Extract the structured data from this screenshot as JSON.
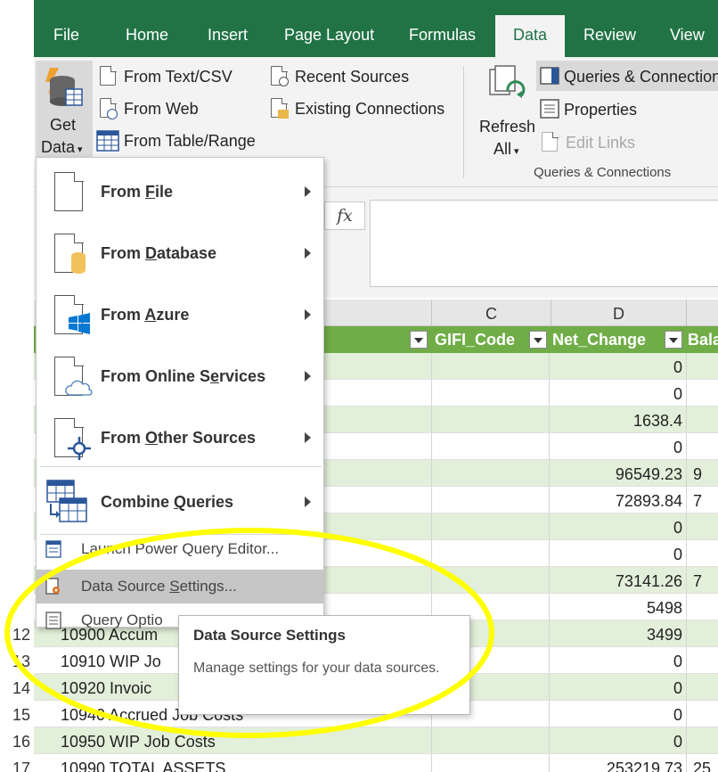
{
  "menubar": {
    "tabs": [
      "File",
      "Home",
      "Insert",
      "Page Layout",
      "Formulas",
      "Data",
      "Review",
      "View"
    ],
    "active": "Data"
  },
  "ribbon": {
    "get_data": [
      "Get",
      "Data"
    ],
    "get_transform": [
      "From Text/CSV",
      "From Web",
      "From Table/Range"
    ],
    "recent": [
      "Recent Sources",
      "Existing Connections"
    ],
    "refresh": [
      "Refresh",
      "All"
    ],
    "queries": [
      "Queries & Connections",
      "Properties",
      "Edit Links"
    ],
    "group_label": "Queries & Connections"
  },
  "formula_bar": {
    "fx": "fx"
  },
  "columns": {
    "c": "C",
    "d": "D"
  },
  "table_header": {
    "gifi": "GIFI_Code",
    "net": "Net_Change",
    "bal": "Bala"
  },
  "rows": [
    {
      "num": "",
      "text": "",
      "net": "0",
      "bal": ""
    },
    {
      "num": "",
      "text": "",
      "net": "0",
      "bal": ""
    },
    {
      "num": "",
      "text": "",
      "net": "1638.4",
      "bal": ""
    },
    {
      "num": "",
      "text": "",
      "net": "0",
      "bal": ""
    },
    {
      "num": "",
      "text": "",
      "net": "96549.23",
      "bal": "9"
    },
    {
      "num": "",
      "text": "",
      "net": "72893.84",
      "bal": "7"
    },
    {
      "num": "",
      "text": "",
      "net": "0",
      "bal": ""
    },
    {
      "num": "",
      "text": "",
      "net": "0",
      "bal": ""
    },
    {
      "num": "",
      "text": "",
      "net": "73141.26",
      "bal": "7"
    },
    {
      "num": "",
      "text": "",
      "net": "5498",
      "bal": ""
    },
    {
      "num": "12",
      "text": "10900 Accum",
      "net": "3499",
      "bal": ""
    },
    {
      "num": "13",
      "text": "10910 WIP Jo",
      "net": "0",
      "bal": ""
    },
    {
      "num": "14",
      "text": "10920 Invoic",
      "net": "0",
      "bal": ""
    },
    {
      "num": "15",
      "text": "10940 Accrued Job Costs",
      "net": "0",
      "bal": ""
    },
    {
      "num": "16",
      "text": "10950 WIP Job Costs",
      "net": "0",
      "bal": ""
    },
    {
      "num": "17",
      "text": "10990 TOTAL ASSETS",
      "net": "253219.73",
      "bal": "25"
    }
  ],
  "dropdown": {
    "items": [
      {
        "pre": "From ",
        "u": "F",
        "post": "ile"
      },
      {
        "pre": "From ",
        "u": "D",
        "post": "atabase"
      },
      {
        "pre": "From ",
        "u": "A",
        "post": "zure"
      },
      {
        "pre": "From Online S",
        "u": "e",
        "post": "rvices"
      },
      {
        "pre": "From ",
        "u": "O",
        "post": "ther Sources"
      },
      {
        "pre": "Combine ",
        "u": "Q",
        "post": "ueries"
      }
    ],
    "small": [
      {
        "pre": "L",
        "u": "a",
        "post": "unch Power Query Editor..."
      },
      {
        "pre": "Data Source ",
        "u": "S",
        "post": "ettings..."
      },
      {
        "pre": "Query Optio",
        "u": "",
        "post": ""
      }
    ]
  },
  "tooltip": {
    "title": "Data Source Settings",
    "body": "Manage settings for your data sources."
  },
  "colors": {
    "excel_green": "#217346",
    "table_green": "#70ad47",
    "band": "#e2efda",
    "annotation": "#ffff00"
  }
}
